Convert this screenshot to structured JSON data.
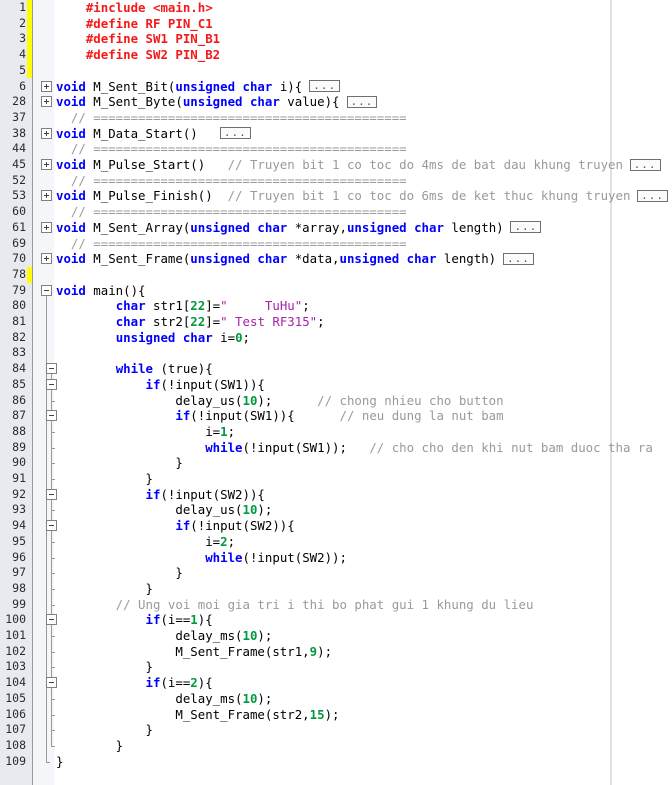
{
  "editor": {
    "name": "code-editor",
    "language": "C",
    "font_size_px": 12.4,
    "line_height_px": 15.7,
    "colors": {
      "background": "#ffffff",
      "gutter_background": "#e8eaf0",
      "fold_margin_background": "#f4f6fa",
      "change_bar": "#ffff00",
      "keyword": "#0000ff",
      "preprocessor": "#f51919",
      "comment": "#9a9a9a",
      "number": "#009a3c",
      "string": "#a821a8",
      "text": "#000000",
      "ruler": "#e2e2e2",
      "fold_marker_border": "#808080"
    },
    "ellipsis_label": "..."
  },
  "lines": [
    {
      "n": "1",
      "changed": true,
      "fold": null,
      "tokens": [
        {
          "t": "    ",
          "c": "pun"
        },
        {
          "t": "#include <main.h>",
          "c": "pre"
        }
      ]
    },
    {
      "n": "2",
      "changed": true,
      "fold": null,
      "tokens": [
        {
          "t": "    ",
          "c": "pun"
        },
        {
          "t": "#define RF PIN_C1",
          "c": "pre"
        }
      ]
    },
    {
      "n": "3",
      "changed": true,
      "fold": null,
      "tokens": [
        {
          "t": "    ",
          "c": "pun"
        },
        {
          "t": "#define SW1 PIN_B1",
          "c": "pre"
        }
      ]
    },
    {
      "n": "4",
      "changed": true,
      "fold": null,
      "tokens": [
        {
          "t": "    ",
          "c": "pun"
        },
        {
          "t": "#define SW2 PIN_B2",
          "c": "pre"
        }
      ]
    },
    {
      "n": "5",
      "changed": true,
      "fold": null,
      "tokens": []
    },
    {
      "n": "6",
      "changed": false,
      "fold": "plus",
      "tokens": [
        {
          "t": "void",
          "c": "kw"
        },
        {
          "t": " M_Sent_Bit(",
          "c": "pun"
        },
        {
          "t": "unsigned char",
          "c": "kw"
        },
        {
          "t": " i){ ",
          "c": "pun"
        }
      ],
      "ellipsis_after": true
    },
    {
      "n": "28",
      "changed": false,
      "fold": "plus",
      "tokens": [
        {
          "t": "void",
          "c": "kw"
        },
        {
          "t": " M_Sent_Byte(",
          "c": "pun"
        },
        {
          "t": "unsigned char",
          "c": "kw"
        },
        {
          "t": " value){ ",
          "c": "pun"
        }
      ],
      "ellipsis_after": true
    },
    {
      "n": "37",
      "changed": false,
      "fold": null,
      "tokens": [
        {
          "t": "  // ==========================================",
          "c": "cmt"
        }
      ]
    },
    {
      "n": "38",
      "changed": false,
      "fold": "plus",
      "tokens": [
        {
          "t": "void",
          "c": "kw"
        },
        {
          "t": " M_Data_Start()   ",
          "c": "pun"
        }
      ],
      "ellipsis_after": true
    },
    {
      "n": "44",
      "changed": false,
      "fold": null,
      "tokens": [
        {
          "t": "  // ==========================================",
          "c": "cmt"
        }
      ]
    },
    {
      "n": "45",
      "changed": false,
      "fold": "plus",
      "tokens": [
        {
          "t": "void",
          "c": "kw"
        },
        {
          "t": " M_Pulse_Start()   ",
          "c": "pun"
        },
        {
          "t": "// Truyen bit 1 co toc do 4ms de bat dau khung truyen ",
          "c": "cmt"
        }
      ],
      "ellipsis_after": true
    },
    {
      "n": "52",
      "changed": false,
      "fold": null,
      "tokens": [
        {
          "t": "  // ==========================================",
          "c": "cmt"
        }
      ]
    },
    {
      "n": "53",
      "changed": false,
      "fold": "plus",
      "tokens": [
        {
          "t": "void",
          "c": "kw"
        },
        {
          "t": " M_Pulse_Finish()  ",
          "c": "pun"
        },
        {
          "t": "// Truyen bit 1 co toc do 6ms de ket thuc khung truyen ",
          "c": "cmt"
        }
      ],
      "ellipsis_after": true
    },
    {
      "n": "60",
      "changed": false,
      "fold": null,
      "tokens": [
        {
          "t": "  // ==========================================",
          "c": "cmt"
        }
      ]
    },
    {
      "n": "61",
      "changed": false,
      "fold": "plus",
      "tokens": [
        {
          "t": "void",
          "c": "kw"
        },
        {
          "t": " M_Sent_Array(",
          "c": "pun"
        },
        {
          "t": "unsigned char",
          "c": "kw"
        },
        {
          "t": " *array,",
          "c": "pun"
        },
        {
          "t": "unsigned char",
          "c": "kw"
        },
        {
          "t": " length) ",
          "c": "pun"
        }
      ],
      "ellipsis_after": true
    },
    {
      "n": "69",
      "changed": false,
      "fold": null,
      "tokens": [
        {
          "t": "  // ==========================================",
          "c": "cmt"
        }
      ]
    },
    {
      "n": "70",
      "changed": false,
      "fold": "plus",
      "tokens": [
        {
          "t": "void",
          "c": "kw"
        },
        {
          "t": " M_Sent_Frame(",
          "c": "pun"
        },
        {
          "t": "unsigned char",
          "c": "kw"
        },
        {
          "t": " *data,",
          "c": "pun"
        },
        {
          "t": "unsigned char",
          "c": "kw"
        },
        {
          "t": " length) ",
          "c": "pun"
        }
      ],
      "ellipsis_after": true
    },
    {
      "n": "78",
      "changed": true,
      "fold": null,
      "tokens": []
    },
    {
      "n": "79",
      "changed": false,
      "fold": "minus",
      "tokens": [
        {
          "t": "void",
          "c": "kw"
        },
        {
          "t": " main(){",
          "c": "pun"
        }
      ]
    },
    {
      "n": "80",
      "changed": false,
      "fold": null,
      "tokens": [
        {
          "t": "        ",
          "c": "pun"
        },
        {
          "t": "char",
          "c": "kw"
        },
        {
          "t": " str1[",
          "c": "pun"
        },
        {
          "t": "22",
          "c": "num"
        },
        {
          "t": "]=",
          "c": "pun"
        },
        {
          "t": "\"     TuHu\"",
          "c": "str"
        },
        {
          "t": ";",
          "c": "pun"
        }
      ]
    },
    {
      "n": "81",
      "changed": false,
      "fold": null,
      "tokens": [
        {
          "t": "        ",
          "c": "pun"
        },
        {
          "t": "char",
          "c": "kw"
        },
        {
          "t": " str2[",
          "c": "pun"
        },
        {
          "t": "22",
          "c": "num"
        },
        {
          "t": "]=",
          "c": "pun"
        },
        {
          "t": "\" Test RF315\"",
          "c": "str"
        },
        {
          "t": ";",
          "c": "pun"
        }
      ]
    },
    {
      "n": "82",
      "changed": false,
      "fold": null,
      "tokens": [
        {
          "t": "        ",
          "c": "pun"
        },
        {
          "t": "unsigned char",
          "c": "kw"
        },
        {
          "t": " i=",
          "c": "pun"
        },
        {
          "t": "0",
          "c": "num"
        },
        {
          "t": ";",
          "c": "pun"
        }
      ]
    },
    {
      "n": "83",
      "changed": false,
      "fold": null,
      "tokens": []
    },
    {
      "n": "84",
      "changed": false,
      "fold": "minus2",
      "tokens": [
        {
          "t": "        ",
          "c": "pun"
        },
        {
          "t": "while",
          "c": "kw"
        },
        {
          "t": " (true){",
          "c": "pun"
        }
      ]
    },
    {
      "n": "85",
      "changed": false,
      "fold": "minus2",
      "tokens": [
        {
          "t": "            ",
          "c": "pun"
        },
        {
          "t": "if",
          "c": "kw"
        },
        {
          "t": "(!input(SW1)){",
          "c": "pun"
        }
      ]
    },
    {
      "n": "86",
      "changed": false,
      "fold": null,
      "tokens": [
        {
          "t": "                delay_us(",
          "c": "pun"
        },
        {
          "t": "10",
          "c": "num"
        },
        {
          "t": ");      ",
          "c": "pun"
        },
        {
          "t": "// chong nhieu cho button",
          "c": "cmt"
        }
      ]
    },
    {
      "n": "87",
      "changed": false,
      "fold": "minus2",
      "tokens": [
        {
          "t": "                ",
          "c": "pun"
        },
        {
          "t": "if",
          "c": "kw"
        },
        {
          "t": "(!input(SW1)){      ",
          "c": "pun"
        },
        {
          "t": "// neu dung la nut bam",
          "c": "cmt"
        }
      ]
    },
    {
      "n": "88",
      "changed": false,
      "fold": null,
      "tokens": [
        {
          "t": "                    i=",
          "c": "pun"
        },
        {
          "t": "1",
          "c": "num"
        },
        {
          "t": ";",
          "c": "pun"
        }
      ]
    },
    {
      "n": "89",
      "changed": false,
      "fold": null,
      "tokens": [
        {
          "t": "                    ",
          "c": "pun"
        },
        {
          "t": "while",
          "c": "kw"
        },
        {
          "t": "(!input(SW1));   ",
          "c": "pun"
        },
        {
          "t": "// cho cho den khi nut bam duoc tha ra",
          "c": "cmt"
        }
      ]
    },
    {
      "n": "90",
      "changed": false,
      "fold": null,
      "tokens": [
        {
          "t": "                }",
          "c": "pun"
        }
      ]
    },
    {
      "n": "91",
      "changed": false,
      "fold": null,
      "tokens": [
        {
          "t": "            }",
          "c": "pun"
        }
      ]
    },
    {
      "n": "92",
      "changed": false,
      "fold": "minus2",
      "tokens": [
        {
          "t": "            ",
          "c": "pun"
        },
        {
          "t": "if",
          "c": "kw"
        },
        {
          "t": "(!input(SW2)){",
          "c": "pun"
        }
      ]
    },
    {
      "n": "93",
      "changed": false,
      "fold": null,
      "tokens": [
        {
          "t": "                delay_us(",
          "c": "pun"
        },
        {
          "t": "10",
          "c": "num"
        },
        {
          "t": ");",
          "c": "pun"
        }
      ]
    },
    {
      "n": "94",
      "changed": false,
      "fold": "minus2",
      "tokens": [
        {
          "t": "                ",
          "c": "pun"
        },
        {
          "t": "if",
          "c": "kw"
        },
        {
          "t": "(!input(SW2)){",
          "c": "pun"
        }
      ]
    },
    {
      "n": "95",
      "changed": false,
      "fold": null,
      "tokens": [
        {
          "t": "                    i=",
          "c": "pun"
        },
        {
          "t": "2",
          "c": "num"
        },
        {
          "t": ";",
          "c": "pun"
        }
      ]
    },
    {
      "n": "96",
      "changed": false,
      "fold": null,
      "tokens": [
        {
          "t": "                    ",
          "c": "pun"
        },
        {
          "t": "while",
          "c": "kw"
        },
        {
          "t": "(!input(SW2));",
          "c": "pun"
        }
      ]
    },
    {
      "n": "97",
      "changed": false,
      "fold": null,
      "tokens": [
        {
          "t": "                }",
          "c": "pun"
        }
      ]
    },
    {
      "n": "98",
      "changed": false,
      "fold": null,
      "tokens": [
        {
          "t": "            }",
          "c": "pun"
        }
      ]
    },
    {
      "n": "99",
      "changed": false,
      "fold": null,
      "tokens": [
        {
          "t": "        // Ung voi moi gia tri i thi bo phat gui 1 khung du lieu",
          "c": "cmt"
        }
      ]
    },
    {
      "n": "100",
      "changed": false,
      "fold": "minus2",
      "tokens": [
        {
          "t": "            ",
          "c": "pun"
        },
        {
          "t": "if",
          "c": "kw"
        },
        {
          "t": "(i==",
          "c": "pun"
        },
        {
          "t": "1",
          "c": "num"
        },
        {
          "t": "){",
          "c": "pun"
        }
      ]
    },
    {
      "n": "101",
      "changed": false,
      "fold": null,
      "tokens": [
        {
          "t": "                delay_ms(",
          "c": "pun"
        },
        {
          "t": "10",
          "c": "num"
        },
        {
          "t": ");",
          "c": "pun"
        }
      ]
    },
    {
      "n": "102",
      "changed": false,
      "fold": null,
      "tokens": [
        {
          "t": "                M_Sent_Frame(str1,",
          "c": "pun"
        },
        {
          "t": "9",
          "c": "num"
        },
        {
          "t": ");",
          "c": "pun"
        }
      ]
    },
    {
      "n": "103",
      "changed": false,
      "fold": null,
      "tokens": [
        {
          "t": "            }",
          "c": "pun"
        }
      ]
    },
    {
      "n": "104",
      "changed": false,
      "fold": "minus2",
      "tokens": [
        {
          "t": "            ",
          "c": "pun"
        },
        {
          "t": "if",
          "c": "kw"
        },
        {
          "t": "(i==",
          "c": "pun"
        },
        {
          "t": "2",
          "c": "num"
        },
        {
          "t": "){",
          "c": "pun"
        }
      ]
    },
    {
      "n": "105",
      "changed": false,
      "fold": null,
      "tokens": [
        {
          "t": "                delay_ms(",
          "c": "pun"
        },
        {
          "t": "10",
          "c": "num"
        },
        {
          "t": ");",
          "c": "pun"
        }
      ]
    },
    {
      "n": "106",
      "changed": false,
      "fold": null,
      "tokens": [
        {
          "t": "                M_Sent_Frame(str2,",
          "c": "pun"
        },
        {
          "t": "15",
          "c": "num"
        },
        {
          "t": ");",
          "c": "pun"
        }
      ]
    },
    {
      "n": "107",
      "changed": false,
      "fold": null,
      "tokens": [
        {
          "t": "            }",
          "c": "pun"
        }
      ]
    },
    {
      "n": "108",
      "changed": false,
      "fold": null,
      "tokens": [
        {
          "t": "        }",
          "c": "pun"
        }
      ]
    },
    {
      "n": "109",
      "changed": false,
      "fold": null,
      "tokens": [
        {
          "t": "}",
          "c": "pun"
        }
      ]
    }
  ]
}
